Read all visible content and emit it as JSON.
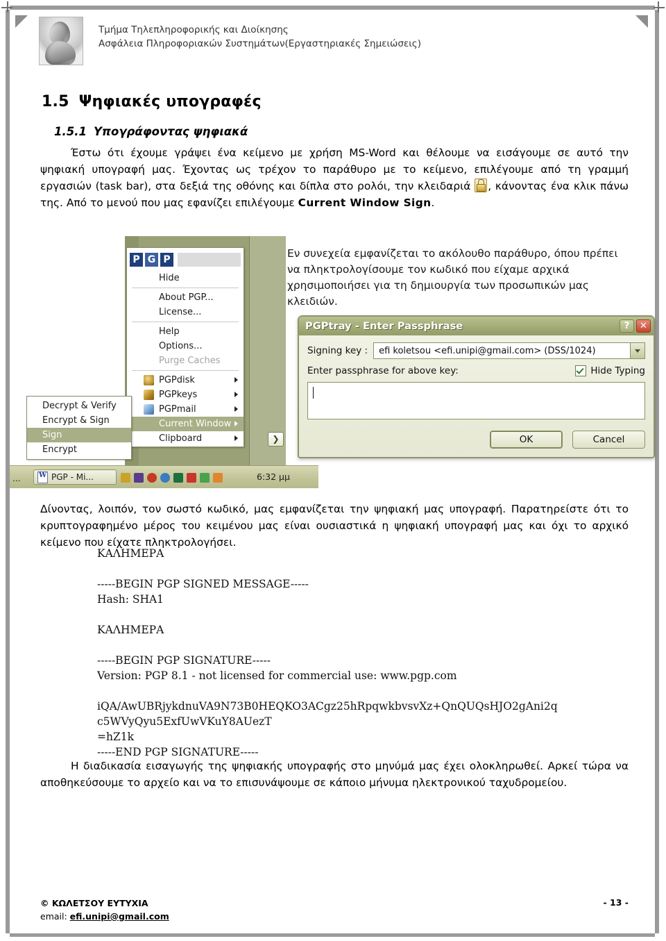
{
  "header": {
    "line1": "Τμήμα Τηλεπληροφορικής και Διοίκησης",
    "line2": "Ασφάλεια Πληροφοριακών Συστημάτων(Εργαστηριακές Σημειώσεις)",
    "crest_alt": "university-crest"
  },
  "headings": {
    "h1_num": "1.5",
    "h1_text": "Ψηφιακές υπογραφές",
    "h2_num": "1.5.1",
    "h2_text": "Υπογράφοντας ψηφιακά"
  },
  "intro": {
    "part1": "Έστω ότι έχουμε γράψει ένα κείμενο με χρήση MS-Word και θέλουμε να εισάγουμε σε αυτό την ψηφιακή υπογραφή μας. Έχοντας ως τρέχον το παράθυρο με το κείμενο, επιλέγουμε από τη γραμμή εργασιών (task bar), στα δεξιά της οθόνης και δίπλα στο ρολόι, την κλειδαριά",
    "part2": ", κάνοντας ένα κλικ πάνω της. Από το μενού που μας εφανίζει επιλέγουμε ",
    "bold_term": "Current Window Sign",
    "part3": "."
  },
  "screenshot": {
    "note": "Εν συνεχεία εμφανίζεται το ακόλουθο παράθυρο, όπου πρέπει να πληκτρολογίσουμε τον κωδικό που είχαμε αρχικά χρησιμοποιήσει για τη δημιουργία των προσωπικών μας κλειδιών.",
    "pgp_menu": {
      "logo": [
        "P",
        "G",
        "P"
      ],
      "items": [
        {
          "label": "Hide",
          "state": "normal",
          "submenu": false,
          "icon": ""
        },
        {
          "label": "About PGP...",
          "state": "normal",
          "submenu": false,
          "icon": ""
        },
        {
          "label": "License...",
          "state": "normal",
          "submenu": false,
          "icon": ""
        },
        {
          "label": "Help",
          "state": "normal",
          "submenu": false,
          "icon": ""
        },
        {
          "label": "Options...",
          "state": "normal",
          "submenu": false,
          "icon": ""
        },
        {
          "label": "Purge Caches",
          "state": "disabled",
          "submenu": false,
          "icon": ""
        },
        {
          "label": "PGPdisk",
          "state": "normal",
          "submenu": true,
          "icon": "pgpdisk-icon"
        },
        {
          "label": "PGPkeys",
          "state": "normal",
          "submenu": true,
          "icon": "pgpkeys-icon"
        },
        {
          "label": "PGPmail",
          "state": "normal",
          "submenu": true,
          "icon": "pgpmail-icon"
        },
        {
          "label": "Current Window",
          "state": "highlighted",
          "submenu": true,
          "icon": ""
        },
        {
          "label": "Clipboard",
          "state": "normal",
          "submenu": true,
          "icon": ""
        }
      ]
    },
    "sub_menu": {
      "items": [
        {
          "label": "Decrypt & Verify",
          "state": "normal"
        },
        {
          "label": "Encrypt & Sign",
          "state": "normal"
        },
        {
          "label": "Sign",
          "state": "highlighted"
        },
        {
          "label": "Encrypt",
          "state": "normal"
        }
      ]
    },
    "taskbar": {
      "overflow": "...",
      "button_label": "PGP - Mi...",
      "clock": "6:32 μμ",
      "tray_colors": [
        "#b5651d",
        "#c23b22",
        "#2e8b57",
        "#d9a441",
        "#1f6f3f",
        "#e07b39"
      ]
    },
    "scroll_button": "❯"
  },
  "dialog": {
    "title": "PGPtray - Enter Passphrase",
    "help_button": "?",
    "close_button": "✕",
    "signing_key_label": "Signing key :",
    "signing_key_value": "efi koletsou <efi.unipi@gmail.com>   (DSS/1024)",
    "passphrase_label": "Enter passphrase for above key:",
    "hide_typing_label": "Hide Typing",
    "hide_typing_checked": true,
    "passphrase_value": "",
    "ok_button": "OK",
    "cancel_button": "Cancel"
  },
  "paragraphs": {
    "result": "Δίνοντας, λοιπόν, τον σωστό κωδικό, μας εμφανίζεται την ψηφιακή μας υπογραφή. Παρατηρείστε ότι το κρυπτογραφημένο μέρος του κειμένου μας είναι ουσιαστικά η ψηφιακή υπογραφή μας και όχι το αρχικό κείμενο που είχατε πληκτρολογήσει.",
    "final": "Η διαδικασία εισαγωγής της ψηφιακής υπογραφής στο μηνύμά μας έχει ολοκληρωθεί. Αρκεί τώρα να αποθηκεύσουμε το αρχείο και να το επισυνάψουμε σε κάποιο μήνυμα ηλεκτρονικού ταχυδρομείου."
  },
  "code_block": {
    "text": "ΚΑΛΗΜΕΡΑ\n\n-----BEGIN PGP SIGNED MESSAGE-----\nHash: SHA1\n\nΚΑΛΗΜΕΡΑ\n\n-----BEGIN PGP SIGNATURE-----\nVersion: PGP 8.1 - not licensed for commercial use: www.pgp.com\n\niQA/AwUBRjykdnuVA9N73B0HEQKO3ACgz25hRpqwkbvsvXz+QnQUQsHJO2gAni2q\nc5WVyQyu5ExfUwVKuY8AUezT\n=hZ1k\n-----END PGP SIGNATURE-----"
  },
  "footer": {
    "copyright": "© ΚΩΛΕΤΣΟΥ ΕΥΤΥΧΙΑ",
    "email_prefix": "email: ",
    "email": "efi.unipi@gmail.com",
    "page_number": "- 13 -"
  }
}
